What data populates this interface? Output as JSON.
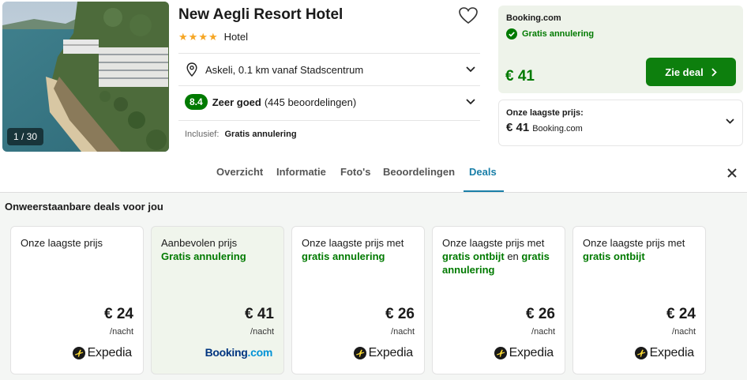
{
  "hotel": {
    "photo_counter": "1 / 30",
    "name": "New Aegli Resort Hotel",
    "stars": 4,
    "type": "Hotel",
    "location": "Askeli, 0.1 km vanaf Stadscentrum",
    "rating_score": "8.4",
    "rating_word": "Zeer goed",
    "rating_count": "(445 beoordelingen)",
    "included_label": "Inclusief:",
    "included_value": "Gratis annulering"
  },
  "deal": {
    "provider": "Booking.com",
    "cancellation": "Gratis annulering",
    "price": "€ 41",
    "button_label": "Zie deal",
    "lowest_label": "Onze laagste prijs:",
    "lowest_price": "€ 41",
    "lowest_provider": "Booking.com",
    "accent_color": "#007a00"
  },
  "tabs": [
    {
      "label": "Overzicht"
    },
    {
      "label": "Informatie"
    },
    {
      "label": "Foto's"
    },
    {
      "label": "Beoordelingen"
    },
    {
      "label": "Deals",
      "active": true
    }
  ],
  "deals_section": {
    "title": "Onweerstaanbare deals voor jou",
    "per_night": "/nacht",
    "cards": [
      {
        "head_plain": "Onze laagste prijs",
        "price": "€ 24",
        "provider": "Expedia"
      },
      {
        "head_plain": "Aanbevolen prijs",
        "head_green": "Gratis annulering",
        "price": "€ 41",
        "provider_main": "Booking",
        "provider_suffix": ".com"
      },
      {
        "head_plain": "Onze laagste prijs met",
        "head_green": "gratis annulering",
        "price": "€ 26",
        "provider": "Expedia"
      },
      {
        "head_plain": "Onze laagste prijs met",
        "head_green_a": "gratis ontbijt",
        "head_join": " en ",
        "head_green_b": "gratis annulering",
        "price": "€ 26",
        "provider": "Expedia"
      },
      {
        "head_plain": "Onze laagste prijs met",
        "head_green": "gratis ontbijt",
        "price": "€ 24",
        "provider": "Expedia"
      }
    ]
  }
}
